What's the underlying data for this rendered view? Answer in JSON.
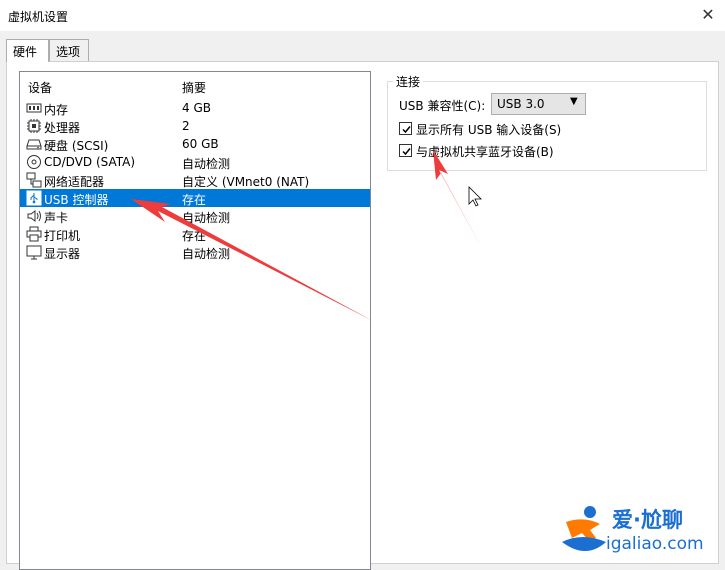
{
  "window": {
    "title": "虚拟机设置"
  },
  "tabs": [
    {
      "label": "硬件",
      "active": true
    },
    {
      "label": "选项",
      "active": false
    }
  ],
  "device_list": {
    "headers": {
      "device": "设备",
      "summary": "摘要"
    },
    "items": [
      {
        "name": "内存",
        "summary": "4 GB",
        "icon": "memory-icon"
      },
      {
        "name": "处理器",
        "summary": "2",
        "icon": "processor-icon"
      },
      {
        "name": "硬盘 (SCSI)",
        "summary": "60 GB",
        "icon": "hard-disk-icon"
      },
      {
        "name": "CD/DVD (SATA)",
        "summary": "自动检测",
        "icon": "cd-dvd-icon"
      },
      {
        "name": "网络适配器",
        "summary": "自定义 (VMnet0 (NAT)",
        "icon": "network-adapter-icon"
      },
      {
        "name": "USB 控制器",
        "summary": "存在",
        "icon": "usb-controller-icon",
        "selected": true
      },
      {
        "name": "声卡",
        "summary": "自动检测",
        "icon": "sound-card-icon"
      },
      {
        "name": "打印机",
        "summary": "存在",
        "icon": "printer-icon"
      },
      {
        "name": "显示器",
        "summary": "自动检测",
        "icon": "monitor-icon"
      }
    ]
  },
  "connection": {
    "group_label": "连接",
    "compat_label": "USB 兼容性(C):",
    "compat_value": "USB 3.0",
    "options": [
      {
        "label": "显示所有 USB 输入设备(S)",
        "checked": true
      },
      {
        "label": "与虚拟机共享蓝牙设备(B)",
        "checked": true
      }
    ]
  },
  "watermark": {
    "line1": "爱·尬聊",
    "line2": "igaliao.com"
  },
  "colors": {
    "selection": "#0078d7",
    "annotation_arrow": "#ee3b3b",
    "watermark": "#1a6fd1"
  }
}
